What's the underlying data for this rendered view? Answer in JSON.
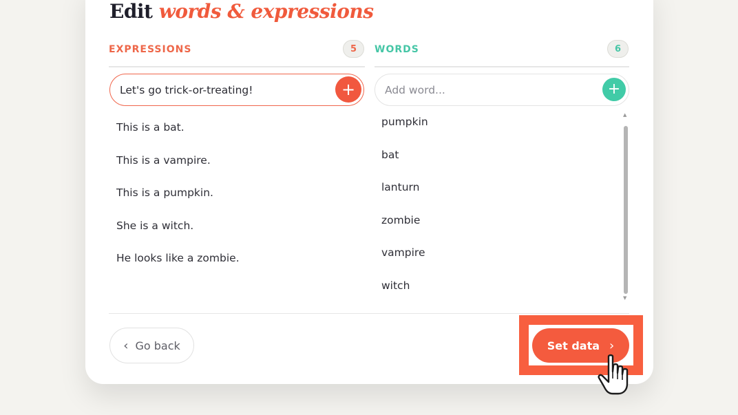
{
  "title": {
    "prefix": "Edit",
    "accent": "words & expressions"
  },
  "expressions": {
    "label": "EXPRESSIONS",
    "count": "5",
    "input_value": "Let's go trick-or-treating!",
    "add_icon": "plus-icon",
    "items": [
      "This is a bat.",
      "This is a vampire.",
      "This is a pumpkin.",
      "She is a witch.",
      "He looks like a zombie."
    ]
  },
  "words": {
    "label": "WORDS",
    "count": "6",
    "placeholder": "Add word...",
    "add_icon": "plus-icon",
    "items": [
      "pumpkin",
      "bat",
      "lanturn",
      "zombie",
      "vampire",
      "witch"
    ]
  },
  "footer": {
    "back_label": "Go back",
    "set_label": "Set data"
  },
  "colors": {
    "accent_orange": "#f45b3e",
    "accent_teal": "#41cba7",
    "highlight": "#f85f3f"
  }
}
